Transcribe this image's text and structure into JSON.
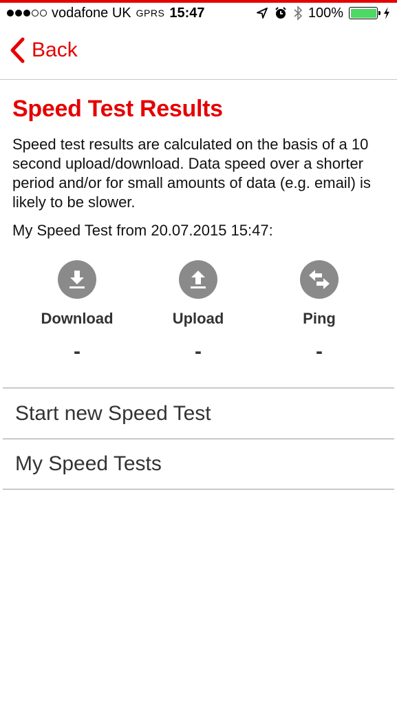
{
  "status_bar": {
    "carrier": "vodafone UK",
    "network": "GPRS",
    "time": "15:47",
    "battery": "100%",
    "signal_bars_filled": 3,
    "signal_bars_total": 5
  },
  "nav": {
    "back_label": "Back"
  },
  "page": {
    "title": "Speed Test Results",
    "description": "Speed test results are calculated on the basis of a 10 second upload/download. Data speed over a shorter period and/or for small amounts of data (e.g. email) is likely to be slower.",
    "test_from": "My Speed Test from 20.07.2015 15:47:"
  },
  "metrics": [
    {
      "icon": "download-icon",
      "label": "Download",
      "value": "-"
    },
    {
      "icon": "upload-icon",
      "label": "Upload",
      "value": "-"
    },
    {
      "icon": "ping-icon",
      "label": "Ping",
      "value": "-"
    }
  ],
  "menu": [
    {
      "label": "Start new Speed Test"
    },
    {
      "label": "My Speed Tests"
    }
  ],
  "colors": {
    "accent": "#e60000",
    "icon_gray": "#8a8a8a",
    "battery_green": "#4cd964"
  }
}
